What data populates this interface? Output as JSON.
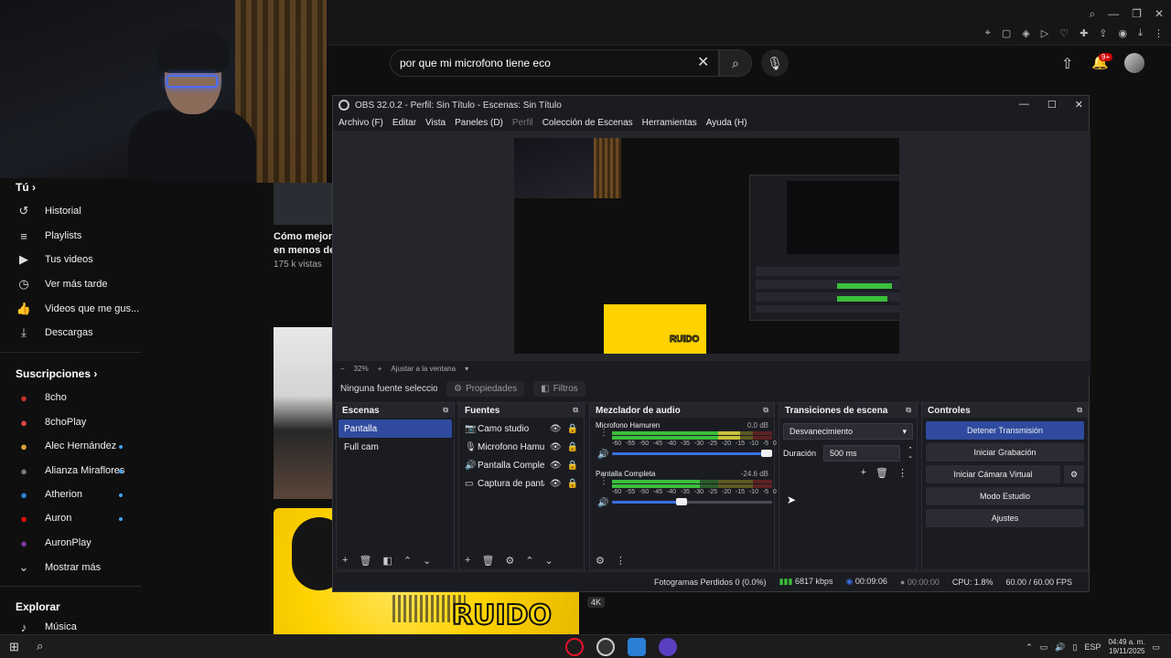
{
  "youtube": {
    "search_value": "por que mi microfono tiene eco",
    "notification_badge": "9+",
    "sidebar": {
      "you_label": "Tú",
      "items": [
        {
          "label": "Historial",
          "icon": "history-icon"
        },
        {
          "label": "Playlists",
          "icon": "playlist-icon"
        },
        {
          "label": "Tus videos",
          "icon": "video-icon"
        },
        {
          "label": "Ver más tarde",
          "icon": "clock-icon"
        },
        {
          "label": "Videos que me gus...",
          "icon": "thumb-up-icon"
        },
        {
          "label": "Descargas",
          "icon": "download-icon"
        }
      ],
      "subs_label": "Suscripciones",
      "subs": [
        {
          "label": "8cho",
          "color": "#c4302b",
          "dot": false
        },
        {
          "label": "8choPlay",
          "color": "#d44",
          "dot": false
        },
        {
          "label": "Alec Hernández",
          "color": "#e0a23b",
          "dot": true
        },
        {
          "label": "Alianza Miraflores",
          "color": "#555",
          "dot": true
        },
        {
          "label": "Atherion",
          "color": "#2b7fd4",
          "dot": true
        },
        {
          "label": "Auron",
          "color": "#d11",
          "dot": true
        },
        {
          "label": "AuronPlay",
          "color": "#7a3a9a",
          "dot": false
        }
      ],
      "show_more": "Mostrar más",
      "explore_label": "Explorar",
      "music_label": "Música"
    },
    "card": {
      "title_line1": "Cómo mejora",
      "title_line2": "en menos de",
      "views": "175 k vistas"
    },
    "thumb_text": "RUIDO",
    "tag_4k": "4K"
  },
  "obs": {
    "title": "OBS 32.0.2 - Perfil: Sin Título - Escenas: Sin Título",
    "menu": [
      "Archivo (F)",
      "Editar",
      "Vista",
      "Paneles (D)",
      "Perfil",
      "Colección de Escenas",
      "Herramientas",
      "Ayuda (H)"
    ],
    "zoom": "32%",
    "fit_label": "Ajustar a la ventana",
    "no_source": "Ninguna fuente seleccionac",
    "properties_label": "Propiedades",
    "filters_label": "Filtros",
    "scenes": {
      "title": "Escenas",
      "items": [
        "Pantalla",
        "Full cam"
      ],
      "selected": 0
    },
    "sources": {
      "title": "Fuentes",
      "items": [
        {
          "label": "Camo studio",
          "icon": "camera-icon"
        },
        {
          "label": "Microfono Hamuren",
          "icon": "microphone-icon"
        },
        {
          "label": "Pantalla Completa",
          "icon": "speaker-icon"
        },
        {
          "label": "Captura de pantalla",
          "icon": "monitor-icon"
        }
      ]
    },
    "mixer": {
      "title": "Mezclador de audio",
      "ticks": [
        "-60",
        "-55",
        "-50",
        "-45",
        "-40",
        "-35",
        "-30",
        "-25",
        "-20",
        "-15",
        "-10",
        "-5",
        "0"
      ],
      "channels": [
        {
          "name": "Microfono Hamuren",
          "db": "0.0 dB",
          "level": 0.8,
          "volume": 1.0
        },
        {
          "name": "Pantalla Completa",
          "db": "-24.6 dB",
          "level": 0.55,
          "volume": 0.47
        }
      ]
    },
    "transitions": {
      "title": "Transiciones de escena",
      "selected": "Desvanecimiento",
      "duration_label": "Duración",
      "duration_value": "500 ms"
    },
    "controls": {
      "title": "Controles",
      "stop_stream": "Detener Transmisión",
      "start_record": "Iniciar Grabación",
      "virtual_cam": "Iniciar Cámara Virtual",
      "studio_mode": "Modo Estudio",
      "settings": "Ajustes"
    },
    "status": {
      "dropped": "Fotogramas Perdidos 0 (0.0%)",
      "bitrate": "6817 kbps",
      "stream_time": "00:09:06",
      "rec_time": "00:00:00",
      "cpu": "CPU: 1.8%",
      "fps": "60.00 / 60.00 FPS"
    }
  },
  "taskbar": {
    "lang": "ESP",
    "time": "04:49 a. m.",
    "date": "19/11/2025"
  }
}
